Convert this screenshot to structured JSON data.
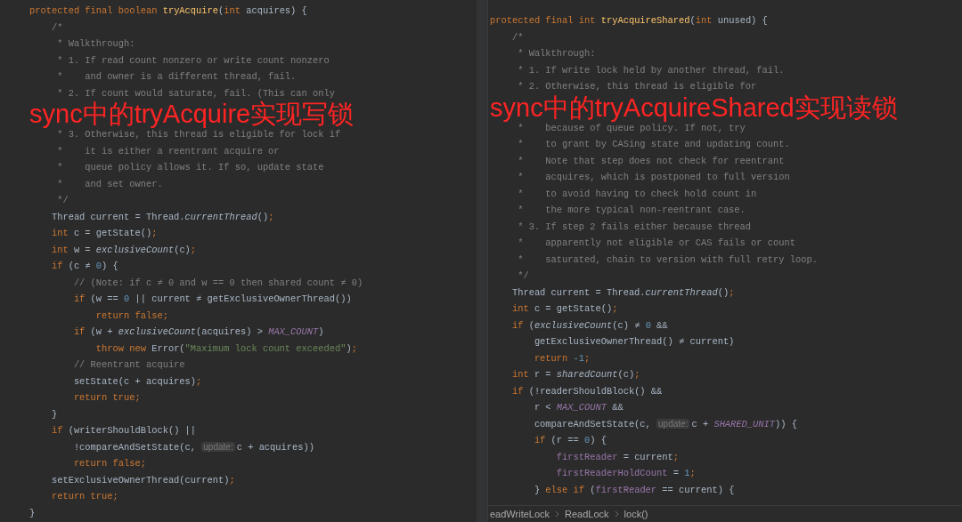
{
  "left_editor": {
    "lines": [
      {
        "tokens": [
          {
            "kind": "kw",
            "text": "protected final boolean "
          },
          {
            "kind": "decl",
            "text": "tryAcquire"
          },
          {
            "kind": "plain",
            "text": "("
          },
          {
            "kind": "kw",
            "text": "int "
          },
          {
            "kind": "plain",
            "text": "acquires) {"
          }
        ]
      },
      {
        "tokens": [
          {
            "kind": "comment",
            "text": "    /*"
          }
        ]
      },
      {
        "tokens": [
          {
            "kind": "comment",
            "text": "     * Walkthrough:"
          }
        ]
      },
      {
        "tokens": [
          {
            "kind": "comment",
            "text": "     * 1. If read count nonzero or write count nonzero"
          }
        ]
      },
      {
        "tokens": [
          {
            "kind": "comment",
            "text": "     *    and owner is a different thread, fail."
          }
        ]
      },
      {
        "tokens": [
          {
            "kind": "comment",
            "text": "     * 2. If count would saturate, fail. (This can only"
          }
        ]
      },
      {
        "kind": "annotation",
        "text": "sync中的tryAcquire实现写锁"
      },
      {
        "tokens": [
          {
            "kind": "comment",
            "text": "     * 3. Otherwise, this thread is eligible for lock if"
          }
        ]
      },
      {
        "tokens": [
          {
            "kind": "comment",
            "text": "     *    it is either a reentrant acquire or"
          }
        ]
      },
      {
        "tokens": [
          {
            "kind": "comment",
            "text": "     *    queue policy allows it. If so, update state"
          }
        ]
      },
      {
        "tokens": [
          {
            "kind": "comment",
            "text": "     *    and set owner."
          }
        ]
      },
      {
        "tokens": [
          {
            "kind": "comment",
            "text": "     */"
          }
        ]
      },
      {
        "tokens": [
          {
            "kind": "plain",
            "text": "    Thread current = Thread."
          },
          {
            "kind": "italic",
            "text": "currentThread"
          },
          {
            "kind": "plain",
            "text": "()"
          },
          {
            "kind": "kw",
            "text": ";"
          }
        ]
      },
      {
        "tokens": [
          {
            "kind": "kw",
            "text": "    int "
          },
          {
            "kind": "plain",
            "text": "c = getState()"
          },
          {
            "kind": "kw",
            "text": ";"
          }
        ]
      },
      {
        "tokens": [
          {
            "kind": "kw",
            "text": "    int "
          },
          {
            "kind": "plain",
            "text": "w = "
          },
          {
            "kind": "italic",
            "text": "exclusiveCount"
          },
          {
            "kind": "plain",
            "text": "(c)"
          },
          {
            "kind": "kw",
            "text": ";"
          }
        ]
      },
      {
        "tokens": [
          {
            "kind": "kw",
            "text": "    if "
          },
          {
            "kind": "plain",
            "text": "(c ≠ "
          },
          {
            "kind": "num",
            "text": "0"
          },
          {
            "kind": "plain",
            "text": ") {"
          }
        ]
      },
      {
        "tokens": [
          {
            "kind": "comment",
            "text": "        // (Note: if c ≠ 0 and w == 0 then shared count ≠ 0)"
          }
        ]
      },
      {
        "tokens": [
          {
            "kind": "kw",
            "text": "        if "
          },
          {
            "kind": "plain",
            "text": "(w == "
          },
          {
            "kind": "num",
            "text": "0"
          },
          {
            "kind": "plain",
            "text": " || current ≠ getExclusiveOwnerThread())"
          }
        ]
      },
      {
        "tokens": [
          {
            "kind": "kw",
            "text": "            return false;"
          }
        ]
      },
      {
        "tokens": [
          {
            "kind": "kw",
            "text": "        if "
          },
          {
            "kind": "plain",
            "text": "(w + "
          },
          {
            "kind": "italic",
            "text": "exclusiveCount"
          },
          {
            "kind": "plain",
            "text": "(acquires) > "
          },
          {
            "kind": "const",
            "text": "MAX_COUNT"
          },
          {
            "kind": "plain",
            "text": ")"
          }
        ]
      },
      {
        "tokens": [
          {
            "kind": "kw",
            "text": "            throw new "
          },
          {
            "kind": "plain",
            "text": "Error("
          },
          {
            "kind": "str",
            "text": "\"Maximum lock count exceeded\""
          },
          {
            "kind": "plain",
            "text": ")"
          },
          {
            "kind": "kw",
            "text": ";"
          }
        ]
      },
      {
        "tokens": [
          {
            "kind": "comment",
            "text": "        // Reentrant acquire"
          }
        ]
      },
      {
        "tokens": [
          {
            "kind": "plain",
            "text": "        setState(c + acquires)"
          },
          {
            "kind": "kw",
            "text": ";"
          }
        ]
      },
      {
        "tokens": [
          {
            "kind": "kw",
            "text": "        return true;"
          }
        ]
      },
      {
        "tokens": [
          {
            "kind": "plain",
            "text": "    }"
          }
        ]
      },
      {
        "tokens": [
          {
            "kind": "kw",
            "text": "    if "
          },
          {
            "kind": "plain",
            "text": "(writerShouldBlock() ||"
          }
        ]
      },
      {
        "tokens": [
          {
            "kind": "plain",
            "text": "        !compareAndSetState(c, "
          },
          {
            "kind": "hint",
            "text": "update:"
          },
          {
            "kind": "plain",
            "text": "c + acquires))"
          }
        ]
      },
      {
        "tokens": [
          {
            "kind": "kw",
            "text": "        return false;"
          }
        ]
      },
      {
        "tokens": [
          {
            "kind": "plain",
            "text": "    setExclusiveOwnerThread(current)"
          },
          {
            "kind": "kw",
            "text": ";"
          }
        ]
      },
      {
        "tokens": [
          {
            "kind": "kw",
            "text": "    return true;"
          }
        ]
      },
      {
        "tokens": [
          {
            "kind": "plain",
            "text": "}"
          }
        ]
      }
    ]
  },
  "right_editor": {
    "lines": [
      {
        "tokens": [
          {
            "kind": "kw",
            "text": "protected final int "
          },
          {
            "kind": "decl",
            "text": "tryAcquireShared"
          },
          {
            "kind": "plain",
            "text": "("
          },
          {
            "kind": "kw",
            "text": "int "
          },
          {
            "kind": "plain",
            "text": "unused) {"
          }
        ]
      },
      {
        "tokens": [
          {
            "kind": "comment",
            "text": "    /*"
          }
        ]
      },
      {
        "tokens": [
          {
            "kind": "comment",
            "text": "     * Walkthrough:"
          }
        ]
      },
      {
        "tokens": [
          {
            "kind": "comment",
            "text": "     * 1. If write lock held by another thread, fail."
          }
        ]
      },
      {
        "tokens": [
          {
            "kind": "comment",
            "text": "     * 2. Otherwise, this thread is eligible for"
          }
        ]
      },
      {
        "kind": "annotation",
        "text": "sync中的tryAcquireShared实现读锁"
      },
      {
        "tokens": [
          {
            "kind": "comment",
            "text": "     *    because of queue policy. If not, try"
          }
        ]
      },
      {
        "tokens": [
          {
            "kind": "comment",
            "text": "     *    to grant by CASing state and updating count."
          }
        ]
      },
      {
        "tokens": [
          {
            "kind": "comment",
            "text": "     *    Note that step does not check for reentrant"
          }
        ]
      },
      {
        "tokens": [
          {
            "kind": "comment",
            "text": "     *    acquires, which is postponed to full version"
          }
        ]
      },
      {
        "tokens": [
          {
            "kind": "comment",
            "text": "     *    to avoid having to check hold count in"
          }
        ]
      },
      {
        "tokens": [
          {
            "kind": "comment",
            "text": "     *    the more typical non-reentrant case."
          }
        ]
      },
      {
        "tokens": [
          {
            "kind": "comment",
            "text": "     * 3. If step 2 fails either because thread"
          }
        ]
      },
      {
        "tokens": [
          {
            "kind": "comment",
            "text": "     *    apparently not eligible or CAS fails or count"
          }
        ]
      },
      {
        "tokens": [
          {
            "kind": "comment",
            "text": "     *    saturated, chain to version with full retry loop."
          }
        ]
      },
      {
        "tokens": [
          {
            "kind": "comment",
            "text": "     */"
          }
        ]
      },
      {
        "tokens": [
          {
            "kind": "plain",
            "text": "    Thread current = Thread."
          },
          {
            "kind": "italic",
            "text": "currentThread"
          },
          {
            "kind": "plain",
            "text": "()"
          },
          {
            "kind": "kw",
            "text": ";"
          }
        ]
      },
      {
        "tokens": [
          {
            "kind": "kw",
            "text": "    int "
          },
          {
            "kind": "plain",
            "text": "c = getState()"
          },
          {
            "kind": "kw",
            "text": ";"
          }
        ]
      },
      {
        "tokens": [
          {
            "kind": "kw",
            "text": "    if "
          },
          {
            "kind": "plain",
            "text": "("
          },
          {
            "kind": "italic",
            "text": "exclusiveCount"
          },
          {
            "kind": "plain",
            "text": "(c) ≠ "
          },
          {
            "kind": "num",
            "text": "0"
          },
          {
            "kind": "plain",
            "text": " &&"
          }
        ]
      },
      {
        "tokens": [
          {
            "kind": "plain",
            "text": "        getExclusiveOwnerThread() ≠ current)"
          }
        ]
      },
      {
        "tokens": [
          {
            "kind": "kw",
            "text": "        return "
          },
          {
            "kind": "num",
            "text": "-1"
          },
          {
            "kind": "kw",
            "text": ";"
          }
        ]
      },
      {
        "tokens": [
          {
            "kind": "kw",
            "text": "    int "
          },
          {
            "kind": "plain",
            "text": "r = "
          },
          {
            "kind": "italic",
            "text": "sharedCount"
          },
          {
            "kind": "plain",
            "text": "(c)"
          },
          {
            "kind": "kw",
            "text": ";"
          }
        ]
      },
      {
        "tokens": [
          {
            "kind": "kw",
            "text": "    if "
          },
          {
            "kind": "plain",
            "text": "(!readerShouldBlock() &&"
          }
        ]
      },
      {
        "tokens": [
          {
            "kind": "plain",
            "text": "        r < "
          },
          {
            "kind": "const",
            "text": "MAX_COUNT"
          },
          {
            "kind": "plain",
            "text": " &&"
          }
        ]
      },
      {
        "tokens": [
          {
            "kind": "plain",
            "text": "        compareAndSetState(c, "
          },
          {
            "kind": "hint",
            "text": "update:"
          },
          {
            "kind": "plain",
            "text": "c + "
          },
          {
            "kind": "const",
            "text": "SHARED_UNIT"
          },
          {
            "kind": "plain",
            "text": ")) {"
          }
        ]
      },
      {
        "tokens": [
          {
            "kind": "kw",
            "text": "        if "
          },
          {
            "kind": "plain",
            "text": "(r == "
          },
          {
            "kind": "num",
            "text": "0"
          },
          {
            "kind": "plain",
            "text": ") {"
          }
        ]
      },
      {
        "tokens": [
          {
            "kind": "field",
            "text": "            firstReader"
          },
          {
            "kind": "plain",
            "text": " = current"
          },
          {
            "kind": "kw",
            "text": ";"
          }
        ]
      },
      {
        "tokens": [
          {
            "kind": "field",
            "text": "            firstReaderHoldCount"
          },
          {
            "kind": "plain",
            "text": " = "
          },
          {
            "kind": "num",
            "text": "1"
          },
          {
            "kind": "kw",
            "text": ";"
          }
        ]
      },
      {
        "tokens": [
          {
            "kind": "plain",
            "text": "        } "
          },
          {
            "kind": "kw",
            "text": "else if "
          },
          {
            "kind": "plain",
            "text": "("
          },
          {
            "kind": "field",
            "text": "firstReader"
          },
          {
            "kind": "plain",
            "text": " == current) {"
          }
        ]
      }
    ]
  },
  "breadcrumb": [
    "eadWriteLock",
    "ReadLock",
    "lock()"
  ]
}
